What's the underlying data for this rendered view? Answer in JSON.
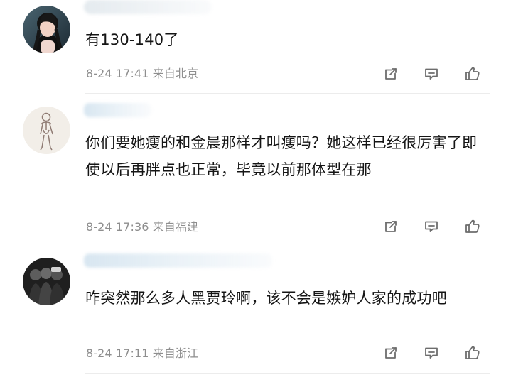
{
  "comments": [
    {
      "text": "有130-140了",
      "time": "8-24 17:41",
      "location": "来自北京"
    },
    {
      "text": "你们要她瘦的和金晨那样才叫瘦吗？她这样已经很厉害了即使以后再胖点也正常，毕竟以前那体型在那",
      "time": "8-24 17:36",
      "location": "来自福建"
    },
    {
      "text": "咋突然那么多人黑贾玲啊，该不会是嫉妒人家的成功吧",
      "time": "8-24 17:11",
      "location": "来自浙江"
    }
  ],
  "icons": {
    "share": "share-icon",
    "comment": "comment-icon",
    "like": "like-icon"
  },
  "colors": {
    "background": "#ffffff",
    "text": "#151515",
    "meta": "#8e8e8e",
    "divider": "#ececec",
    "icon": "#6d6d6d"
  }
}
